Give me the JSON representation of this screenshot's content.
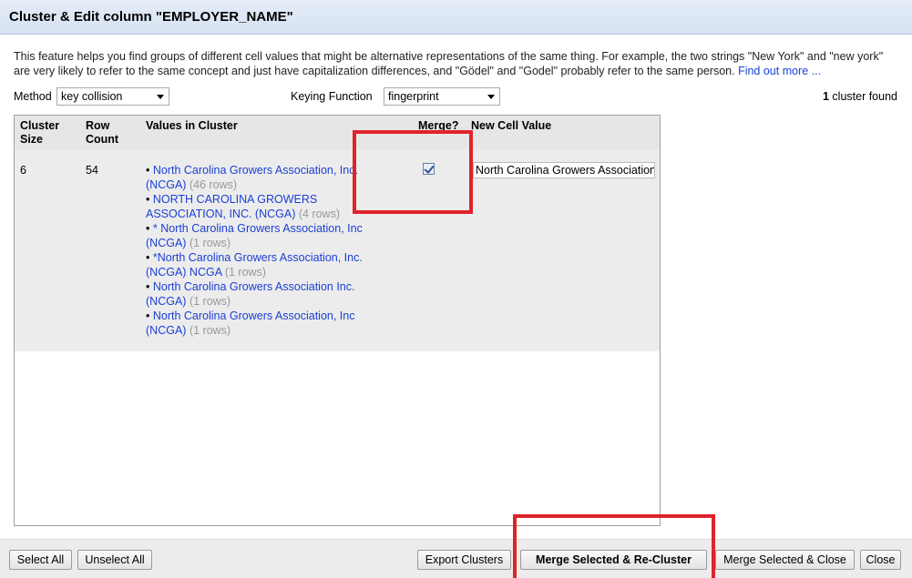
{
  "dialog": {
    "title": "Cluster & Edit column \"EMPLOYER_NAME\"",
    "description": "This feature helps you find groups of different cell values that might be alternative representations of the same thing. For example, the two strings \"New York\" and \"new york\" are very likely to refer to the same concept and just have capitalization differences, and \"Gödel\" and \"Godel\" probably refer to the same person.",
    "find_out_more": "Find out more ..."
  },
  "controls": {
    "method_label": "Method",
    "method_value": "key collision",
    "keying_label": "Keying Function",
    "keying_value": "fingerprint",
    "cluster_count": "1",
    "cluster_count_suffix": "cluster found"
  },
  "table": {
    "headers": {
      "cluster_size_line1": "Cluster",
      "cluster_size_line2": "Size",
      "row_count_line1": "Row",
      "row_count_line2": "Count",
      "values": "Values in Cluster",
      "merge": "Merge?",
      "new_value": "New Cell Value"
    },
    "rows": [
      {
        "cluster_size": "6",
        "row_count": "54",
        "merge": true,
        "new_value": "North Carolina Growers Association, Inc. (NCGA)",
        "values": [
          {
            "text": "North Carolina Growers Association, Inc. (NCGA)",
            "count": "(46 rows)"
          },
          {
            "text": "NORTH CAROLINA GROWERS ASSOCIATION, INC. (NCGA)",
            "count": "(4 rows)"
          },
          {
            "text": "* North Carolina Growers Association, Inc (NCGA)",
            "count": "(1 rows)"
          },
          {
            "text": "*North Carolina Growers Association, Inc. (NCGA) NCGA",
            "count": "(1 rows)"
          },
          {
            "text": "North Carolina Growers Association Inc. (NCGA)",
            "count": "(1 rows)"
          },
          {
            "text": "North Carolina Growers Association, Inc (NCGA)",
            "count": "(1 rows)"
          }
        ]
      }
    ]
  },
  "footer": {
    "select_all": "Select All",
    "unselect_all": "Unselect All",
    "export_clusters": "Export Clusters",
    "merge_recluster": "Merge Selected & Re-Cluster",
    "merge_close": "Merge Selected & Close",
    "close": "Close"
  },
  "colors": {
    "link": "#1a3fd6",
    "annotation": "#e0232b"
  }
}
